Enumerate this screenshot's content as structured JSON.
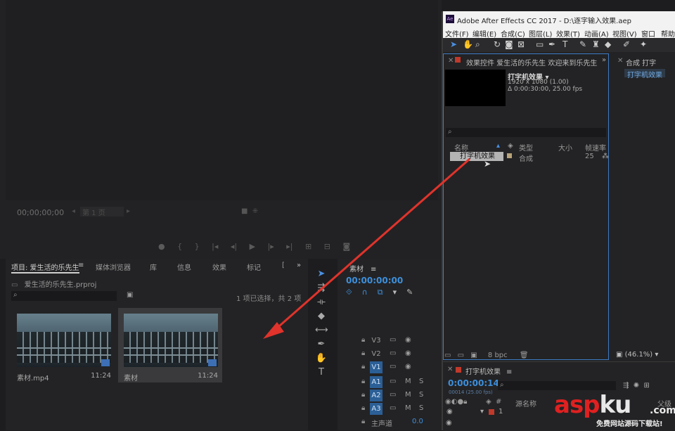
{
  "premiere": {
    "monitor": {
      "timecode": "00;00;00;00",
      "page_label": "第 1 页"
    },
    "project_panel": {
      "tabs": [
        "项目: 爱生活的乐先生",
        "媒体浏览器",
        "库",
        "信息",
        "效果",
        "标记",
        "["
      ],
      "project_file": "爱生活的乐先生.prproj",
      "selection_count": "1 项已选择，共 2 项",
      "items": [
        {
          "name": "素材.mp4",
          "duration": "11:24"
        },
        {
          "name": "素材",
          "duration": "11:24"
        }
      ]
    },
    "timeline": {
      "title": "素材",
      "timecode": "00:00:00:00",
      "tracks": [
        {
          "name": "V3",
          "c1": "▭",
          "c2": "◉",
          "c3": ""
        },
        {
          "name": "V2",
          "c1": "▭",
          "c2": "◉",
          "c3": ""
        },
        {
          "name": "V1",
          "c1": "▭",
          "c2": "◉",
          "c3": "",
          "selected": true
        },
        {
          "name": "A1",
          "c1": "▭",
          "c2": "M",
          "c3": "S",
          "selected": true
        },
        {
          "name": "A2",
          "c1": "▭",
          "c2": "M",
          "c3": "S",
          "selected": true
        },
        {
          "name": "A3",
          "c1": "▭",
          "c2": "M",
          "c3": "S",
          "selected": true
        }
      ],
      "master_label": "主声道",
      "master_value": "0.0"
    }
  },
  "after_effects": {
    "title": "Adobe After Effects CC 2017 - D:\\逐字输入效果.aep",
    "logo": "Ae",
    "menu": [
      "文件(F)",
      "编辑(E)",
      "合成(C)",
      "图层(L)",
      "效果(T)",
      "动画(A)",
      "视图(V)",
      "窗口",
      "帮助("
    ],
    "project": {
      "tab_label": "效果控件 爱生活的乐先生  欢迎来到乐先生",
      "comp_name": "打字机效果 ▾",
      "comp_resolution": "1920 x 1080 (1.00)",
      "comp_duration": "Δ 0:00:30:00, 25.00 fps",
      "columns": {
        "name": "名称",
        "type": "类型",
        "size": "大小",
        "rate": "帧速率"
      },
      "row": {
        "name": "打字机效果",
        "type": "合成",
        "rate": "25"
      },
      "bit_depth": "8 bpc"
    },
    "comp_panel": {
      "tab_label": "合成 打字",
      "sub_tab": "打字机效果",
      "zoom": "(46.1%)"
    },
    "timeline": {
      "tab_label": "打字机效果",
      "timecode": "0:00:00:14",
      "sub": "00014 (25.00 fps)",
      "col_source": "源名称",
      "col_parent": "父级",
      "layer_num": "1"
    }
  },
  "watermark": {
    "main_a": "asp",
    "main_b": "ku",
    "com": ".com",
    "sub": "免费网站源码下载站!"
  },
  "colors": {
    "accent_blue": "#3d8fdb",
    "arrow_red": "#e0332b",
    "panel_bg": "#232325"
  }
}
